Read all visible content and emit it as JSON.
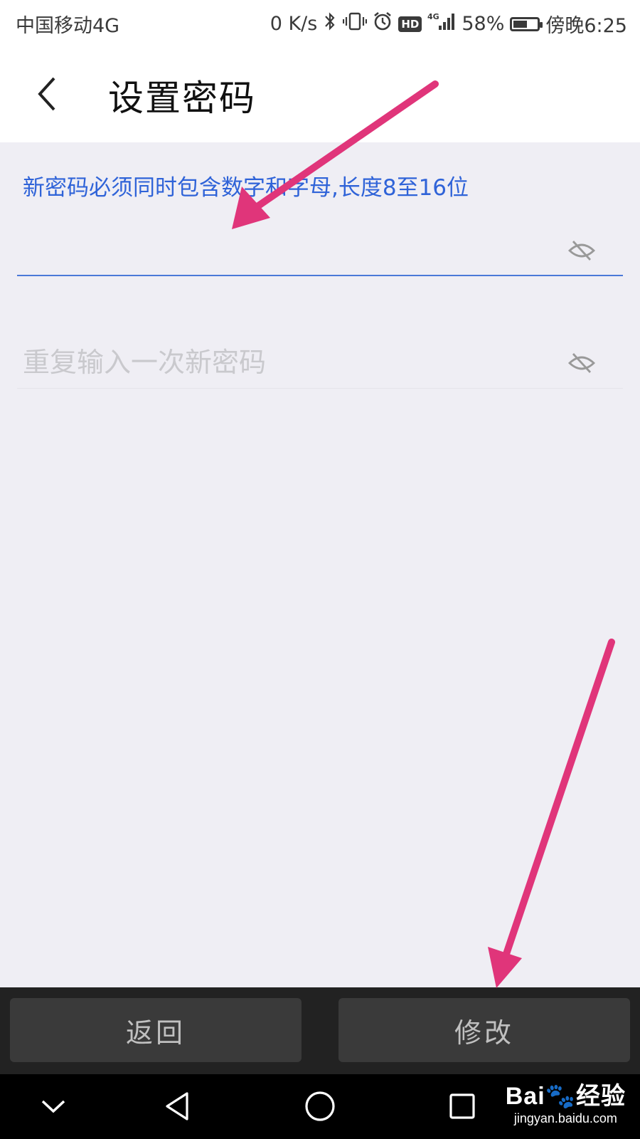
{
  "status_bar": {
    "carrier": "中国移动4G",
    "speed": "0 K/s",
    "hd": "HD",
    "network": "4G",
    "battery_percent_text": "58%",
    "battery_level": 0.58,
    "time": "傍晚6:25"
  },
  "header": {
    "title": "设置密码"
  },
  "form": {
    "hint": "新密码必须同时包含数字和字母,长度8至16位",
    "new_password": {
      "value": "",
      "placeholder": ""
    },
    "confirm_password": {
      "value": "",
      "placeholder": "重复输入一次新密码"
    }
  },
  "actions": {
    "back_label": "返回",
    "modify_label": "修改"
  },
  "watermark": {
    "logo": "Bai🐾经验",
    "url": "jingyan.baidu.com"
  },
  "colors": {
    "accent": "#2f63d8",
    "arrow": "#e0357a",
    "background": "#efeef4"
  }
}
